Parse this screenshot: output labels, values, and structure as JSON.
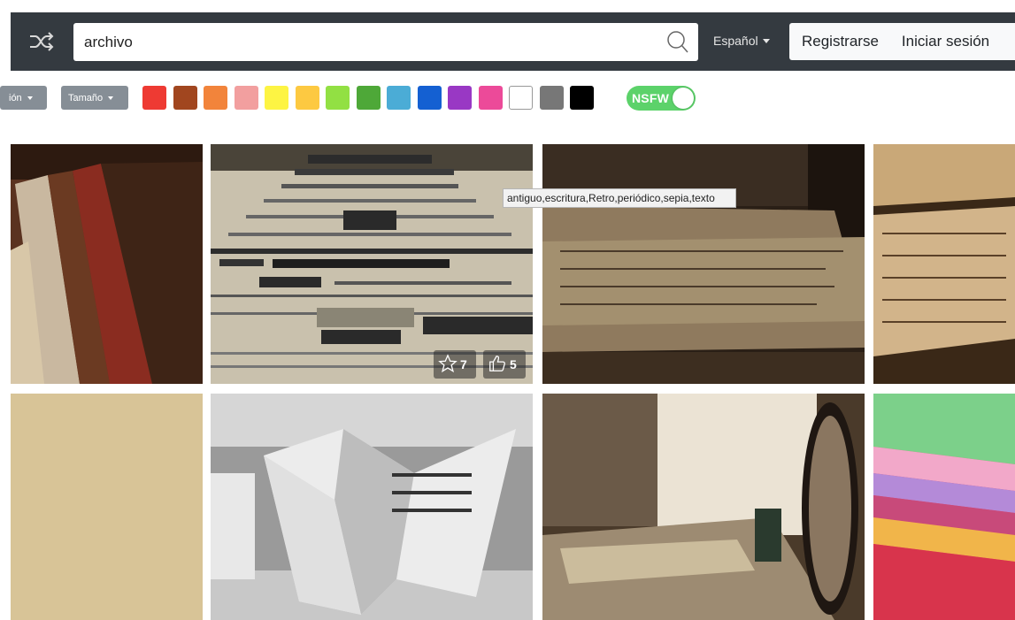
{
  "header": {
    "search": {
      "value": "archivo",
      "placeholder": ""
    },
    "language": "Español",
    "register": "Registrarse",
    "login": "Iniciar sesión"
  },
  "filters": {
    "orientation_label": "ión",
    "size_label": "Tamaño",
    "colors": [
      "#ee3a33",
      "#a1461f",
      "#f2843b",
      "#f29f9f",
      "#fdf443",
      "#fdc941",
      "#92e043",
      "#4ea838",
      "#4bacd6",
      "#1460d2",
      "#9938c4",
      "#ec4a99",
      "#ffffff",
      "#777777",
      "#000000"
    ],
    "nsfw_label": "NSFW",
    "nsfw_on": true
  },
  "gallery": {
    "tooltip": "antiguo,escritura,Retro,periódico,sepia,texto",
    "favorites": "7",
    "likes": "5",
    "colors": {
      "books": "#5a3220",
      "newspaper": "#c9c1ad",
      "letters": "#8f7a5e",
      "paper_strip": "#c9a878",
      "parchment": "#d8c497",
      "origami": "#9a9a9a",
      "desk": "#4a3a2a",
      "colorful": "#c84a7a"
    }
  }
}
